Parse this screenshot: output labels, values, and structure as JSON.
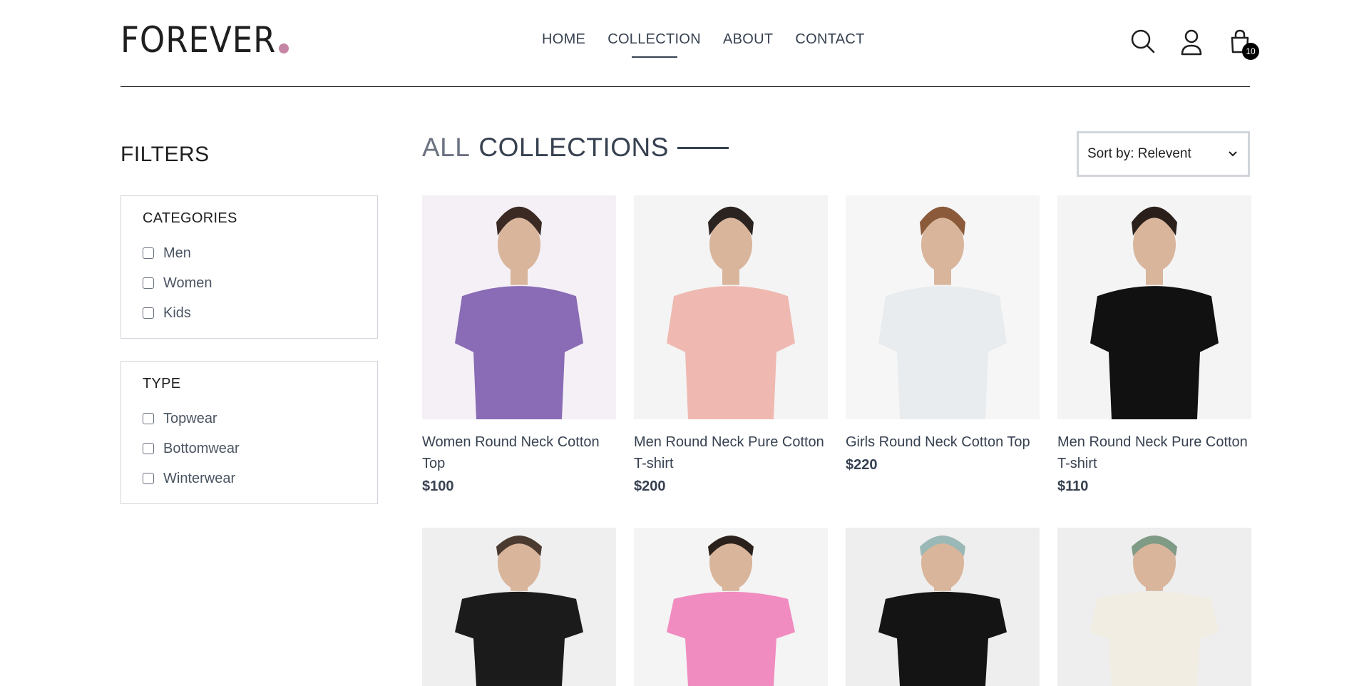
{
  "brand": {
    "name": "FOREVER",
    "dot_color": "#c586a5"
  },
  "nav": [
    {
      "label": "HOME",
      "active": false
    },
    {
      "label": "COLLECTION",
      "active": true
    },
    {
      "label": "ABOUT",
      "active": false
    },
    {
      "label": "CONTACT",
      "active": false
    }
  ],
  "header_icons": {
    "search": "search-icon",
    "profile": "user-icon",
    "cart": "shopping-bag-icon",
    "cart_count": "10"
  },
  "filters": {
    "title": "FILTERS",
    "categories": {
      "heading": "CATEGORIES",
      "options": [
        "Men",
        "Women",
        "Kids"
      ]
    },
    "type": {
      "heading": "TYPE",
      "options": [
        "Topwear",
        "Bottomwear",
        "Winterwear"
      ]
    }
  },
  "collection": {
    "title_light": "ALL",
    "title_dark": "COLLECTIONS",
    "sort_label": "Sort by: Relevent"
  },
  "products": [
    {
      "name": "Women Round Neck Cotton Top",
      "price": "$100",
      "palette": [
        "#8a6bb5",
        "#f4f0f6",
        "#3b2a24"
      ]
    },
    {
      "name": "Men Round Neck Pure Cotton T-shirt",
      "price": "$200",
      "palette": [
        "#efb9b1",
        "#f4f4f4",
        "#2a2320"
      ]
    },
    {
      "name": "Girls Round Neck Cotton Top",
      "price": "$220",
      "palette": [
        "#e8ecef",
        "#f6f6f6",
        "#8a5a3a"
      ]
    },
    {
      "name": "Men Round Neck Pure Cotton T-shirt",
      "price": "$110",
      "palette": [
        "#111111",
        "#f4f4f4",
        "#2a1f1a"
      ]
    }
  ],
  "products_row2": [
    {
      "palette": [
        "#1b1b1b",
        "#efefef",
        "#4a3a30"
      ]
    },
    {
      "palette": [
        "#f08cc0",
        "#f4f4f4",
        "#2b211c"
      ]
    },
    {
      "palette": [
        "#141414",
        "#eeeeee",
        "#9ab8b6"
      ]
    },
    {
      "palette": [
        "#f1ede2",
        "#eeeeee",
        "#7f9a85"
      ]
    }
  ]
}
